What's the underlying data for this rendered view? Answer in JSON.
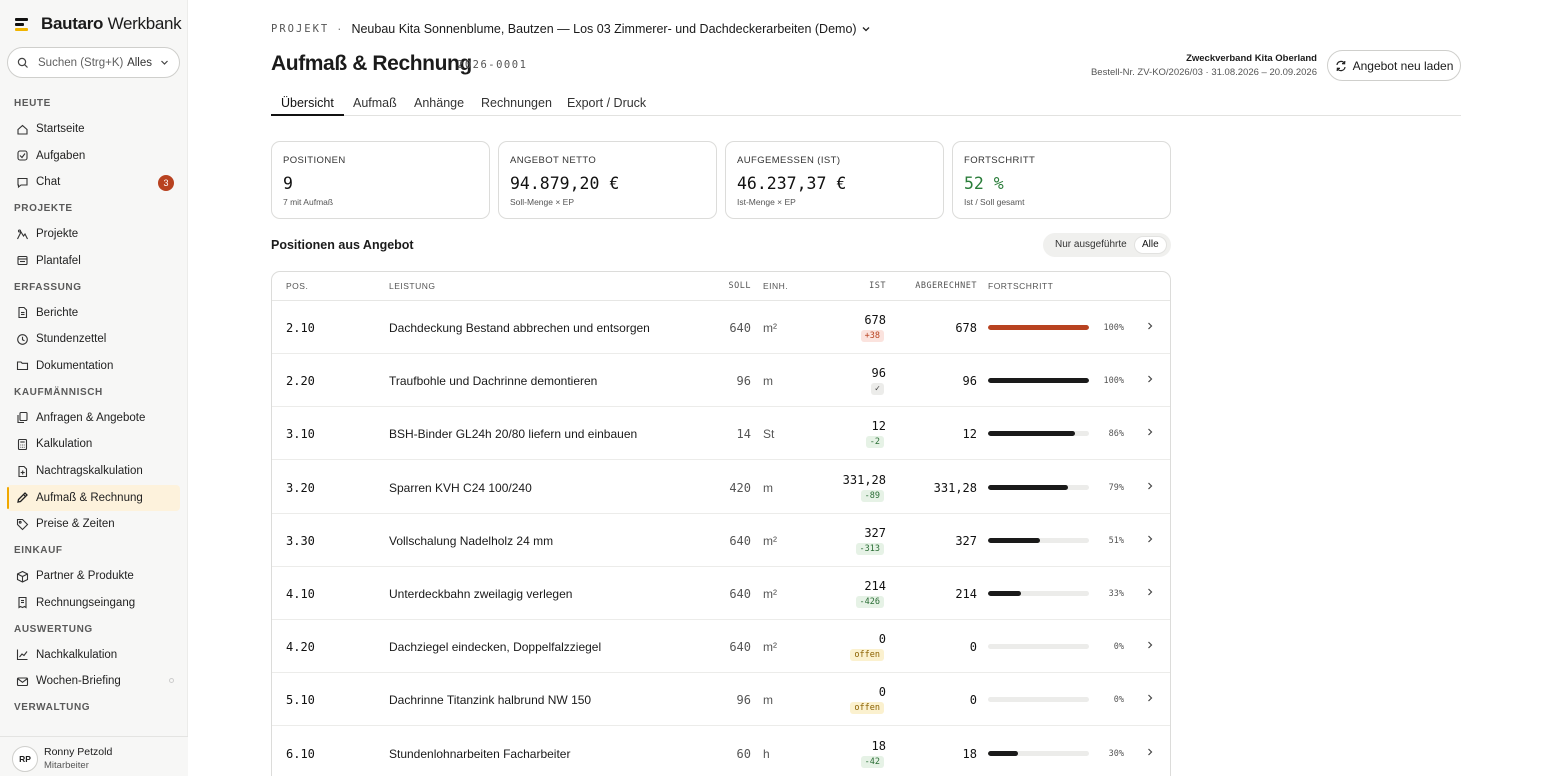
{
  "brand": {
    "name_bold": "Bautaro",
    "name_light": " Werkbank"
  },
  "search": {
    "placeholder": "Suchen (Strg+K)",
    "scope": "Alles"
  },
  "sidebar": {
    "sections": [
      {
        "label": "HEUTE",
        "items": [
          {
            "label": "Startseite",
            "icon": "home-icon"
          },
          {
            "label": "Aufgaben",
            "icon": "check-square-icon"
          },
          {
            "label": "Chat",
            "icon": "chat-icon",
            "badge": "3"
          }
        ]
      },
      {
        "label": "PROJEKTE",
        "items": [
          {
            "label": "Projekte",
            "icon": "mountain-icon"
          },
          {
            "label": "Plantafel",
            "icon": "board-icon"
          }
        ]
      },
      {
        "label": "ERFASSUNG",
        "items": [
          {
            "label": "Berichte",
            "icon": "document-icon"
          },
          {
            "label": "Stundenzettel",
            "icon": "clock-icon"
          },
          {
            "label": "Dokumentation",
            "icon": "folder-icon"
          }
        ]
      },
      {
        "label": "KAUFMÄNNISCH",
        "items": [
          {
            "label": "Anfragen & Angebote",
            "icon": "copy-icon"
          },
          {
            "label": "Kalkulation",
            "icon": "calculator-icon"
          },
          {
            "label": "Nachtragskalkulation",
            "icon": "document-plus-icon"
          },
          {
            "label": "Aufmaß & Rechnung",
            "icon": "pencil-ruler-icon",
            "active": true
          },
          {
            "label": "Preise & Zeiten",
            "icon": "tag-icon"
          }
        ]
      },
      {
        "label": "EINKAUF",
        "items": [
          {
            "label": "Partner & Produkte",
            "icon": "box-icon"
          },
          {
            "label": "Rechnungseingang",
            "icon": "receipt-icon"
          }
        ]
      },
      {
        "label": "AUSWERTUNG",
        "items": [
          {
            "label": "Nachkalkulation",
            "icon": "chart-line-icon"
          },
          {
            "label": "Wochen-Briefing",
            "icon": "mail-icon"
          }
        ]
      },
      {
        "label": "VERWALTUNG",
        "items": []
      }
    ]
  },
  "user": {
    "initials": "RP",
    "name": "Ronny Petzold",
    "role": "Mitarbeiter"
  },
  "header": {
    "crumb_label": "PROJEKT",
    "crumb_sep": "·",
    "project": "Neubau Kita Sonnenblume, Bautzen — Los 03 Zimmerer- und Dachdeckerarbeiten (Demo)",
    "title": "Aufmaß & Rechnung",
    "doc_no": "2026-0001",
    "client_name": "Zweckverband Kita Oberland",
    "client_meta": "Bestell-Nr. ZV-KO/2026/03 · 31.08.2026 – 20.09.2026",
    "reload_label": "Angebot neu laden"
  },
  "tabs": [
    "Übersicht",
    "Aufmaß",
    "Anhänge",
    "Rechnungen",
    "Export / Druck"
  ],
  "kpis": [
    {
      "label": "POSITIONEN",
      "value": "9",
      "sub": "7 mit Aufmaß"
    },
    {
      "label": "ANGEBOT NETTO",
      "value": "94.879,20 €",
      "sub": "Soll-Menge × EP"
    },
    {
      "label": "AUFGEMESSEN (IST)",
      "value": "46.237,37 €",
      "sub": "Ist-Menge × EP"
    },
    {
      "label": "FORTSCHRITT",
      "value": "52 %",
      "sub": "Ist / Soll gesamt"
    }
  ],
  "positions": {
    "title": "Positionen aus Angebot",
    "filter_executed": "Nur ausgeführte",
    "filter_all": "Alle",
    "columns": {
      "pos": "POS.",
      "leistung": "LEISTUNG",
      "soll": "SOLL",
      "einh": "EINH.",
      "ist": "IST",
      "abgerechnet": "ABGERECHNET",
      "fortschritt": "FORTSCHRITT"
    },
    "rows": [
      {
        "pos": "2.10",
        "leistung": "Dachdeckung Bestand abbrechen und entsorgen",
        "soll": "640",
        "einh": "m²",
        "ist": "678",
        "diff": "+38",
        "diff_type": "plus",
        "abgerechnet": "678",
        "progress": 100,
        "pct": "100%"
      },
      {
        "pos": "2.20",
        "leistung": "Traufbohle und Dachrinne demontieren",
        "soll": "96",
        "einh": "m",
        "ist": "96",
        "diff": "✓",
        "diff_type": "ok",
        "abgerechnet": "96",
        "progress": 100,
        "pct": "100%"
      },
      {
        "pos": "3.10",
        "leistung": "BSH-Binder GL24h 20/80 liefern und einbauen",
        "soll": "14",
        "einh": "St",
        "ist": "12",
        "diff": "-2",
        "diff_type": "minus",
        "abgerechnet": "12",
        "progress": 86,
        "pct": "86%"
      },
      {
        "pos": "3.20",
        "leistung": "Sparren KVH C24 100/240",
        "soll": "420",
        "einh": "m",
        "ist": "331,28",
        "diff": "-89",
        "diff_type": "minus",
        "abgerechnet": "331,28",
        "progress": 79,
        "pct": "79%"
      },
      {
        "pos": "3.30",
        "leistung": "Vollschalung Nadelholz 24 mm",
        "soll": "640",
        "einh": "m²",
        "ist": "327",
        "diff": "-313",
        "diff_type": "minus",
        "abgerechnet": "327",
        "progress": 51,
        "pct": "51%"
      },
      {
        "pos": "4.10",
        "leistung": "Unterdeckbahn zweilagig verlegen",
        "soll": "640",
        "einh": "m²",
        "ist": "214",
        "diff": "-426",
        "diff_type": "minus",
        "abgerechnet": "214",
        "progress": 33,
        "pct": "33%"
      },
      {
        "pos": "4.20",
        "leistung": "Dachziegel eindecken, Doppelfalzziegel",
        "soll": "640",
        "einh": "m²",
        "ist": "0",
        "diff": "offen",
        "diff_type": "open",
        "abgerechnet": "0",
        "progress": 0,
        "pct": "0%"
      },
      {
        "pos": "5.10",
        "leistung": "Dachrinne Titanzink halbrund NW 150",
        "soll": "96",
        "einh": "m",
        "ist": "0",
        "diff": "offen",
        "diff_type": "open",
        "abgerechnet": "0",
        "progress": 0,
        "pct": "0%"
      },
      {
        "pos": "6.10",
        "leistung": "Stundenlohnarbeiten Facharbeiter",
        "soll": "60",
        "einh": "h",
        "ist": "18",
        "diff": "-42",
        "diff_type": "minus",
        "abgerechnet": "18",
        "progress": 30,
        "pct": "30%"
      }
    ]
  },
  "colors": {
    "accent": "#f0a800",
    "over": "#b84220",
    "bar": "#1a1a1a",
    "green": "#2a7d3a"
  }
}
